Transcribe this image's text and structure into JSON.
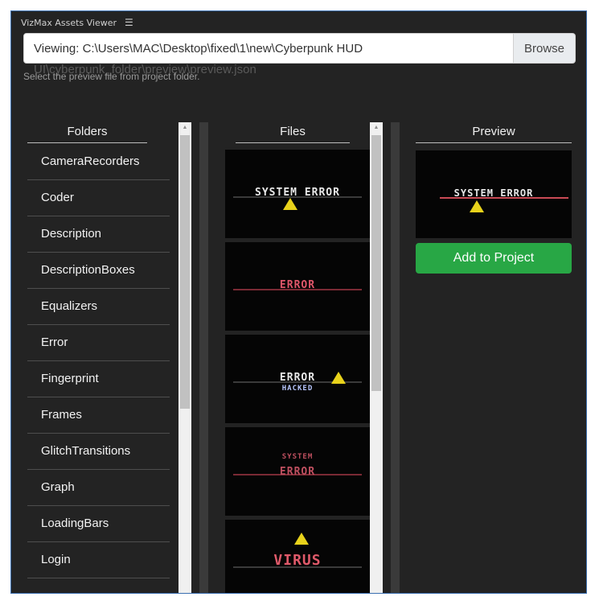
{
  "window": {
    "title": "VizMax Assets Viewer",
    "menu_icon": "hamburger-menu-icon"
  },
  "path_bar": {
    "value": "Viewing: C:\\Users\\MAC\\Desktop\\fixed\\1\\new\\Cyberpunk HUD",
    "overflow_text": "UI\\cyberpunk_folder\\preview\\preview.json",
    "browse_label": "Browse",
    "hint": "Select the preview file from project folder."
  },
  "columns": {
    "folders": "Folders",
    "files": "Files",
    "preview": "Preview"
  },
  "folders": [
    "CameraRecorders",
    "Coder",
    "Description",
    "DescriptionBoxes",
    "Equalizers",
    "Error",
    "Fingerprint",
    "Frames",
    "GlitchTransitions",
    "Graph",
    "LoadingBars",
    "Login"
  ],
  "files": [
    {
      "label": "SYSTEM ERROR",
      "color": "#e8e8e8"
    },
    {
      "label": "ERROR",
      "color": "#e0566a"
    },
    {
      "label": "ERROR",
      "sub": "HACKED",
      "color": "#e8e8e8"
    },
    {
      "label": "ERROR",
      "sub": "SYSTEM",
      "color": "#c05060"
    },
    {
      "label": "VIRUS",
      "color": "#e05a6a"
    }
  ],
  "preview": {
    "label": "SYSTEM ERROR",
    "add_label": "Add to Project"
  },
  "colors": {
    "accent": "#28a745",
    "background": "#232323",
    "window_border": "#3b6fb0"
  }
}
